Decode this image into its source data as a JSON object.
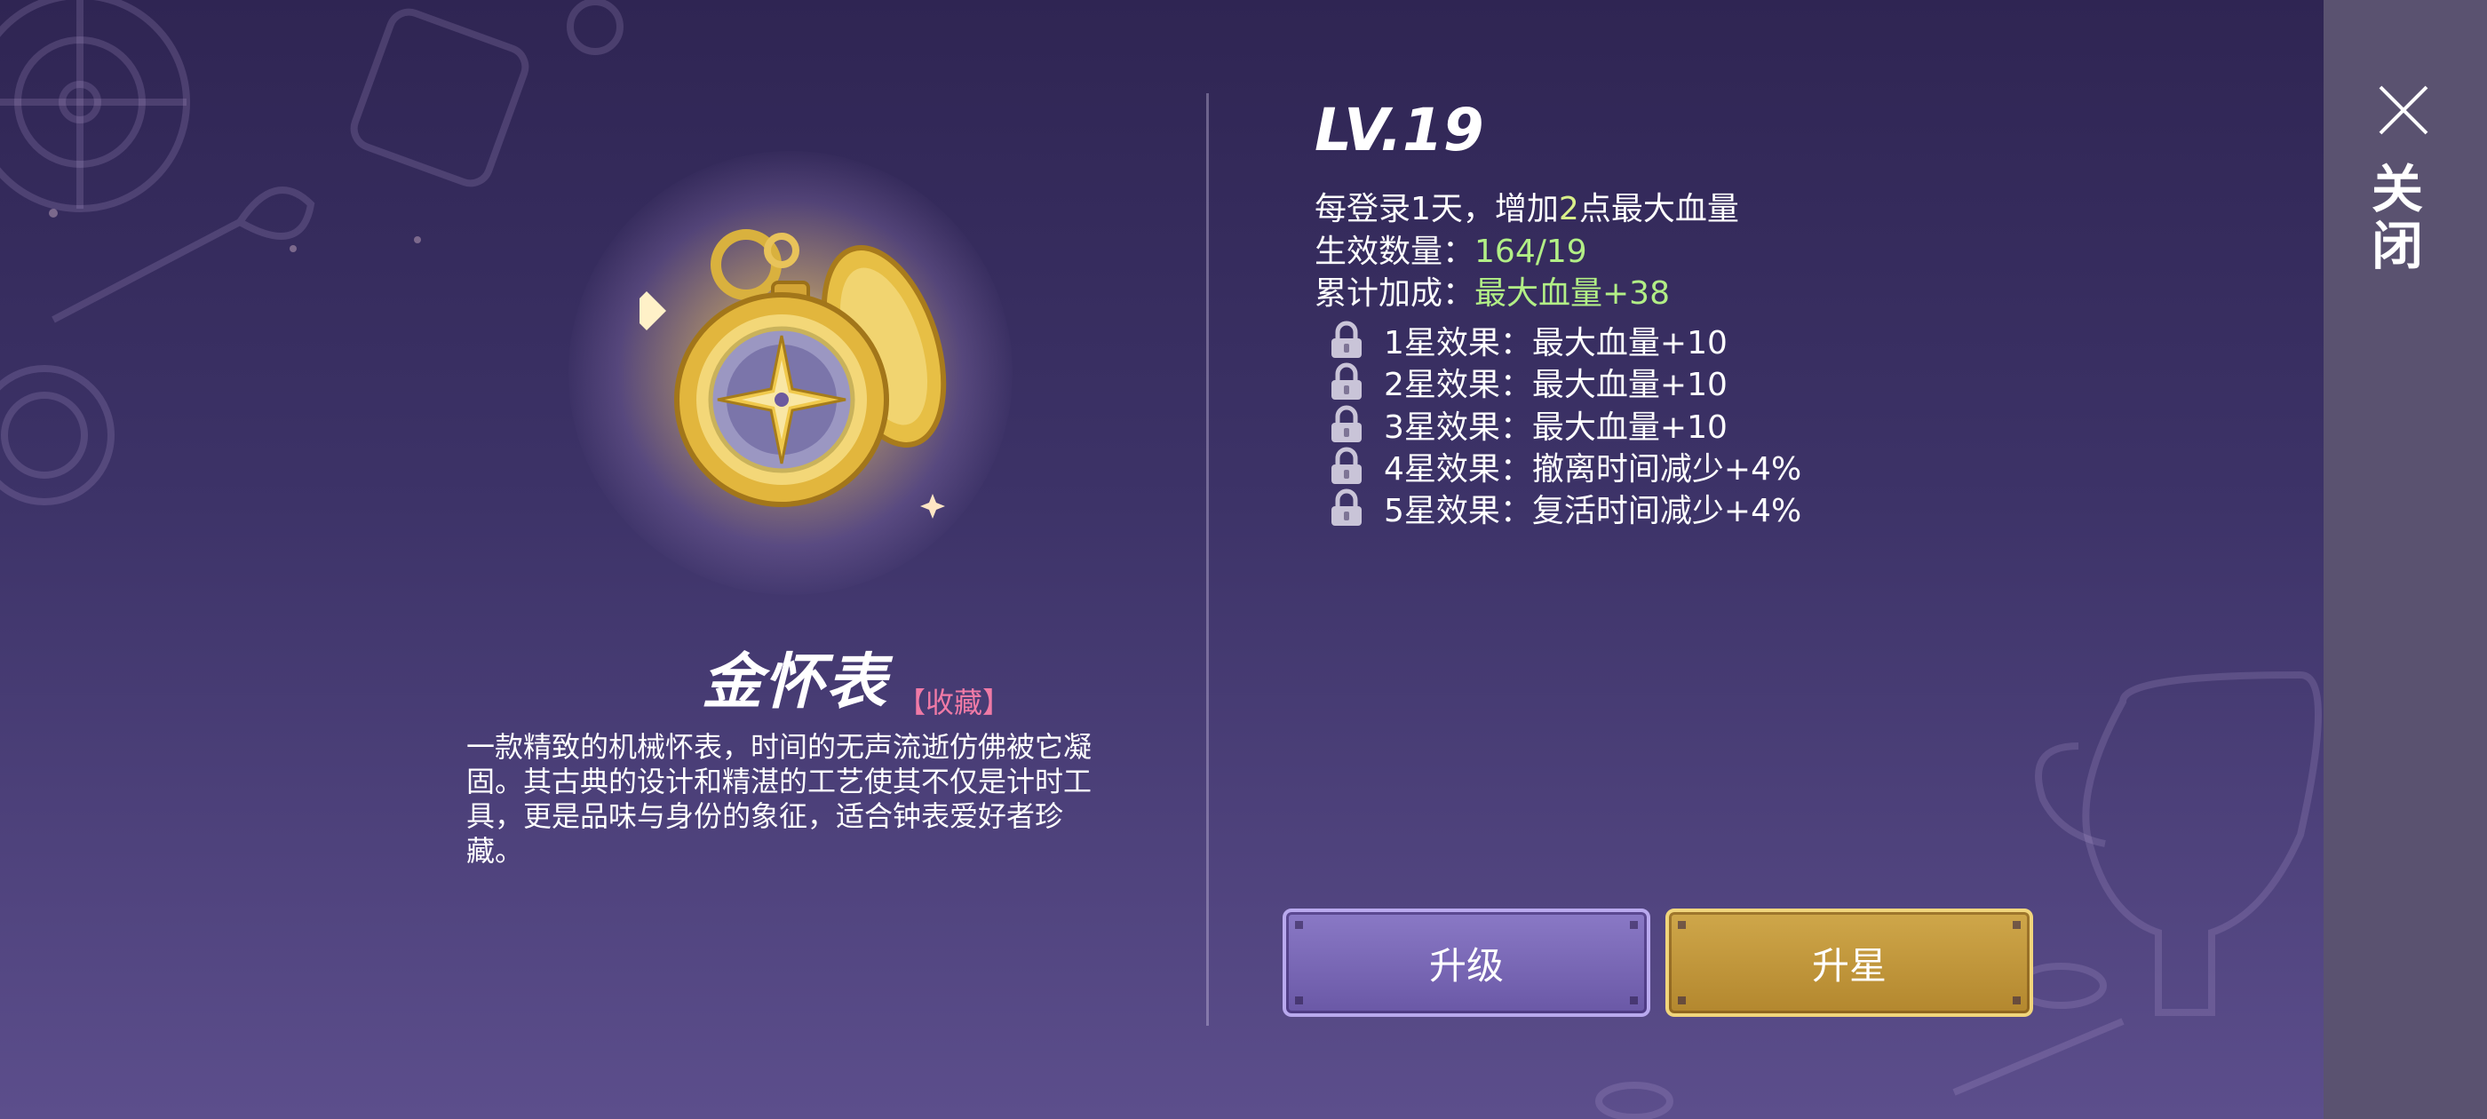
{
  "item": {
    "name": "金怀表",
    "tag": "【收藏】",
    "description": "一款精致的机械怀表，时间的无声流逝仿佛被它凝固。其古典的设计和精湛的工艺使其不仅是计时工具，更是品味与身份的象征，适合钟表爱好者珍藏。",
    "icon": "gold-pocket-watch-icon"
  },
  "stats": {
    "level": "LV.19",
    "daily_prefix": "每登录1天，增加",
    "daily_value": "2",
    "daily_suffix": "点最大血量",
    "count_label": "生效数量：",
    "count_value": "164/19",
    "total_label": "累计加成：",
    "total_value": "最大血量+38"
  },
  "effects": [
    {
      "label": "1星效果：",
      "value": "最大血量+10",
      "locked": true
    },
    {
      "label": "2星效果：",
      "value": "最大血量+10",
      "locked": true
    },
    {
      "label": "3星效果：",
      "value": "最大血量+10",
      "locked": true
    },
    {
      "label": "4星效果：",
      "value": "撤离时间减少+4%",
      "locked": true
    },
    {
      "label": "5星效果：",
      "value": "复活时间减少+4%",
      "locked": true
    }
  ],
  "buttons": {
    "upgrade": "升级",
    "star_up": "升星"
  },
  "close": {
    "label": "关闭",
    "icon": "close-icon"
  },
  "colors": {
    "background": "#3d3368",
    "highlight_yellow": "#d9f08a",
    "highlight_green": "#b2ef86",
    "tag_pink": "#f07aa6",
    "upgrade_button": "#7866b4",
    "star_button": "#c09a3e",
    "close_bar": "#5a5270"
  }
}
